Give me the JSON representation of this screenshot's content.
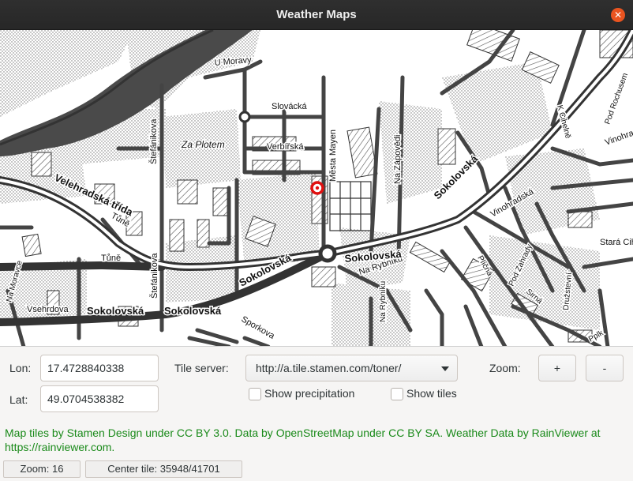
{
  "window": {
    "title": "Weather Maps"
  },
  "map": {
    "street_labels": [
      "U Moravy",
      "Slovácká",
      "Za Plotem",
      "Verbířská",
      "Města Mayen",
      "Na Zápovědi",
      "Štefánikova",
      "Velehradská třída",
      "Tůně",
      "Sokolovská",
      "Na Rybníku",
      "Vsehrdova",
      "Na Moravce",
      "Sporkova",
      "Sokolovská",
      "Sokolovská",
      "Sokolovská",
      "Vinohradská",
      "K Cihelně",
      "Vinohrad",
      "Pod Rochusem",
      "Stará Cihelna",
      "Pod Zahrady",
      "Plíčná",
      "Družstevní",
      "Sirná",
      "Na Rybníku",
      "Pplk",
      "Štefánikova",
      "Tůně",
      "Sokolovská"
    ],
    "marker_color": "#e01010"
  },
  "controls": {
    "lon_label": "Lon:",
    "lon_value": "17.4728840338",
    "lat_label": "Lat:",
    "lat_value": "49.0704538382",
    "tile_server_label": "Tile server:",
    "tile_server_value": "http://a.tile.stamen.com/toner/",
    "zoom_label": "Zoom:",
    "zoom_in_label": "+",
    "zoom_out_label": "-",
    "show_precipitation_label": "Show precipitation",
    "show_precipitation_checked": false,
    "show_tiles_label": "Show tiles",
    "show_tiles_checked": false
  },
  "attribution": "Map tiles by Stamen Design under CC BY 3.0. Data by OpenStreetMap under CC BY SA. Weather Data by RainViewer at https://rainviewer.com.",
  "status": {
    "zoom": "Zoom: 16",
    "center_tile": "Center tile: 35948/41701"
  },
  "colors": {
    "titlebar": "#2c2c2c",
    "close_button": "#e95420",
    "attribution": "#1a8a1a"
  }
}
